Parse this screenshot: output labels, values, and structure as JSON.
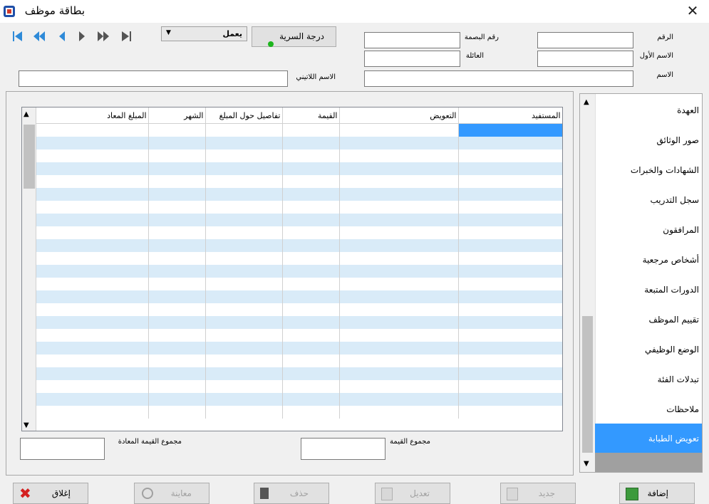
{
  "window": {
    "title": "بطاقة موظف",
    "close_glyph": "✕"
  },
  "navigation": {
    "first": "first-record-icon",
    "prev_fast": "prev-fast-icon",
    "prev": "prev-icon",
    "next": "next-icon",
    "next_fast": "next-fast-icon",
    "last": "last-record-icon"
  },
  "header": {
    "status_select_value": "يعمل",
    "secrecy_button_label": "درجة السرية",
    "fields": {
      "id_label": "الرقم",
      "fingerprint_label": "رقم البصمة",
      "first_name_label": "الاسم الأول",
      "family_label": "العائلة",
      "name_label": "الاسم",
      "latin_name_label": "الاسم اللاتيني"
    }
  },
  "grid": {
    "columns": [
      "المستفيد",
      "التعويض",
      "القيمة",
      "تفاصيل حول المبلغ",
      "الشهر",
      "المبلغ المعاد"
    ]
  },
  "totals": {
    "sum_value_label": "مجموع القيمة",
    "sum_returned_label": "مجموع القيمة المعادة"
  },
  "sidebar": {
    "items": [
      {
        "label": "العهدة"
      },
      {
        "label": "صور الوثائق"
      },
      {
        "label": "الشهادات والخبرات"
      },
      {
        "label": "سجل التدريب"
      },
      {
        "label": "المرافقون"
      },
      {
        "label": "أشخاص مرجعية"
      },
      {
        "label": "الدورات المتبعة"
      },
      {
        "label": "تقييم الموظف"
      },
      {
        "label": "الوضع الوظيفي"
      },
      {
        "label": "تبدلات الفئة"
      },
      {
        "label": "ملاحظات"
      },
      {
        "label": "تعويض الطبابة"
      }
    ],
    "selected": "تعويض الطبابة"
  },
  "footer": {
    "add_label": "إضافة",
    "new_label": "جديد",
    "edit_label": "تعديل",
    "delete_label": "حذف",
    "preview_label": "معاينة",
    "close_label": "إغلاق"
  },
  "colors": {
    "accent": "#3399ff",
    "row_alt": "#d9ebf8",
    "nav_blue": "#2e8ad8"
  }
}
